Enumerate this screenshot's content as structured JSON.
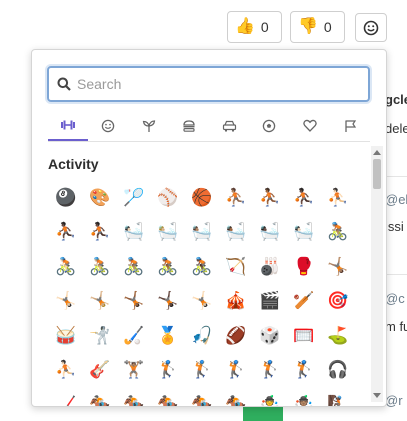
{
  "reactions": {
    "thumbs_up": {
      "emoji": "👍",
      "count": "0"
    },
    "thumbs_down": {
      "emoji": "👎",
      "count": "0"
    },
    "add_reaction_icon": "smiley-icon"
  },
  "background": {
    "fragments": [
      "gcle",
      "dele",
      "@el",
      "issi",
      "@c",
      "m fu",
      "@r"
    ]
  },
  "picker": {
    "search": {
      "placeholder": "Search",
      "value": ""
    },
    "tabs": [
      {
        "name": "activity",
        "icon": "dumbbell-icon",
        "active": true
      },
      {
        "name": "people",
        "icon": "smiley-icon",
        "active": false
      },
      {
        "name": "nature",
        "icon": "sprout-icon",
        "active": false
      },
      {
        "name": "food",
        "icon": "burger-icon",
        "active": false
      },
      {
        "name": "travel",
        "icon": "car-icon",
        "active": false
      },
      {
        "name": "sports",
        "icon": "soccer-ball-icon",
        "active": false
      },
      {
        "name": "symbols",
        "icon": "heart-icon",
        "active": false
      },
      {
        "name": "flags",
        "icon": "flag-icon",
        "active": false
      }
    ],
    "category_title": "Activity",
    "emojis": [
      "🎱",
      "🎨",
      "🏸",
      "⚾",
      "🏀",
      "⛹🏽",
      "⛹🏾",
      "⛹🏿",
      "⛹🏻",
      "⛹🏿",
      "⛹🏿",
      "🛀🏻",
      "🛀🏼",
      "🛀🏽",
      "🛀🏾",
      "🛀🏿",
      "🛀🏻",
      "🚴🏽",
      "🚴🏻",
      "🚴🏼",
      "🚴🏽",
      "🚴🏾",
      "🚴🏿",
      "🏹",
      "🎳",
      "🥊",
      "🤸🏽",
      "🤸🏻",
      "🤸🏼",
      "🤸🏾",
      "🤸🏿",
      "🤸🏻",
      "🎪",
      "🎬",
      "🏏",
      "🎯",
      "🥁",
      "🤺",
      "🏑",
      "🏅",
      "🎣",
      "🏈",
      "🎲",
      "🥅",
      "⛳",
      "⛹🏻",
      "🎸",
      "🏋🏽",
      "🏌🏻",
      "🏌🏼",
      "🏌🏽",
      "🏌🏾",
      "🏌🏿",
      "🎧",
      "🏒",
      "🏇🏻",
      "🏇🏼",
      "🏇🏽",
      "🏇🏾",
      "🏇🏿",
      "🤹",
      "🤹🏽",
      "🧗🏿"
    ],
    "colors": {
      "accent": "#6b5fce",
      "focus": "#7ea6d6"
    }
  }
}
